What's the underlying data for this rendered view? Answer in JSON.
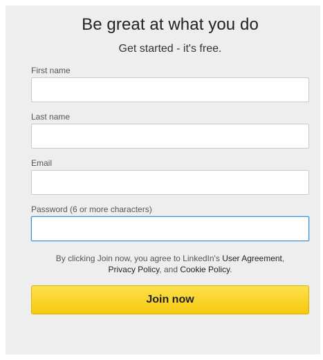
{
  "headline": "Be great at what you do",
  "subhead": "Get started - it's free.",
  "form": {
    "first_name": {
      "label": "First name",
      "value": ""
    },
    "last_name": {
      "label": "Last name",
      "value": ""
    },
    "email": {
      "label": "Email",
      "value": ""
    },
    "password": {
      "label": "Password (6 or more characters)",
      "value": ""
    }
  },
  "agreement": {
    "prefix": "By clicking Join now, you agree to LinkedIn's ",
    "user_agreement": "User Agreement",
    "sep1": ",",
    "privacy_policy": "Privacy Policy",
    "sep2": ", and ",
    "cookie_policy": "Cookie Policy",
    "suffix": "."
  },
  "join_label": "Join now",
  "colors": {
    "panel_bg": "#eeeeee",
    "button_yellow": "#f8d21f",
    "focus_border": "#3a8fd3"
  }
}
